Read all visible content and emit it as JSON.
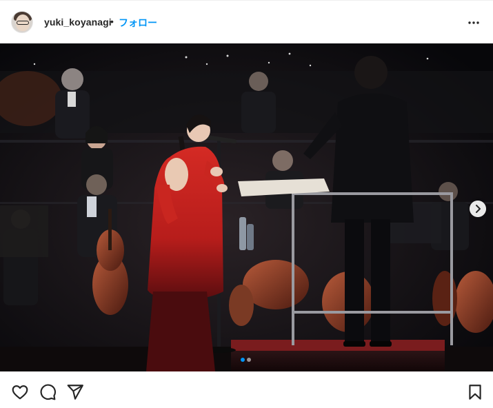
{
  "header": {
    "username": "yuki_koyanagi",
    "separator": "•",
    "follow_label": "フォロー",
    "more_icon": "more-horizontal-icon"
  },
  "media": {
    "description_icon": "concert-photo",
    "carousel_total": 2,
    "carousel_active": 0,
    "next_icon": "chevron-right-icon"
  },
  "actions": {
    "like_icon": "heart-icon",
    "comment_icon": "comment-icon",
    "share_icon": "send-icon",
    "save_icon": "bookmark-icon"
  },
  "colors": {
    "accent": "#0095f6",
    "text": "#262626",
    "dress": "#c8231f"
  }
}
